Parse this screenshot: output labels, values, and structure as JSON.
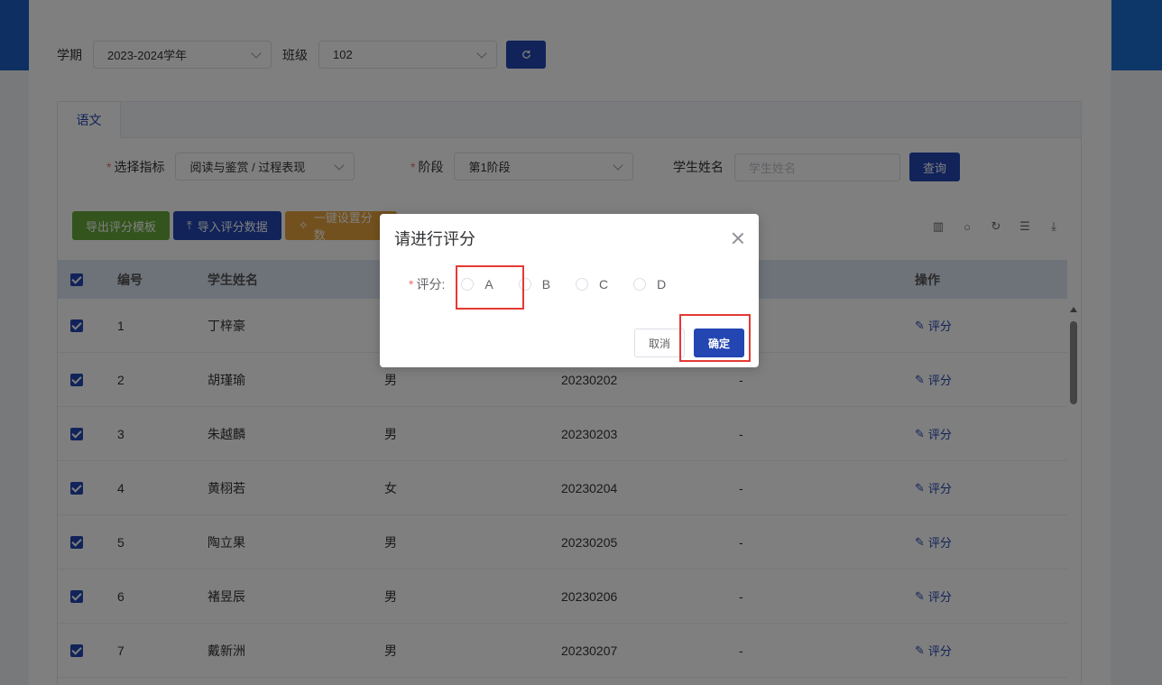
{
  "filters": {
    "term_label": "学期",
    "term_value": "2023-2024学年",
    "class_label": "班级",
    "class_value": "102",
    "refresh_icon": "refresh-icon"
  },
  "tabs": [
    {
      "label": "语文"
    }
  ],
  "form": {
    "indicator_label": "选择指标",
    "indicator_value": "阅读与鉴赏 / 过程表现",
    "stage_label": "阶段",
    "stage_value": "第1阶段",
    "student_label": "学生姓名",
    "student_placeholder": "学生姓名",
    "query_label": "查询"
  },
  "toolbar": {
    "export_label": "导出评分模板",
    "import_label": "导入评分数据",
    "batch_label": "一键设置分数",
    "export_color": "#67a93b",
    "import_color": "#2346b3",
    "batch_color": "#e6a23c"
  },
  "table": {
    "headers": [
      "编号",
      "学生姓名",
      "操作"
    ],
    "rows": [
      {
        "no": "1",
        "name": "丁梓豪",
        "gender": "",
        "id": "",
        "score": "",
        "op": "评分"
      },
      {
        "no": "2",
        "name": "胡瑾瑜",
        "gender": "男",
        "id": "20230202",
        "score": "-",
        "op": "评分"
      },
      {
        "no": "3",
        "name": "朱越麟",
        "gender": "男",
        "id": "20230203",
        "score": "-",
        "op": "评分"
      },
      {
        "no": "4",
        "name": "黄栩若",
        "gender": "女",
        "id": "20230204",
        "score": "-",
        "op": "评分"
      },
      {
        "no": "5",
        "name": "陶立果",
        "gender": "男",
        "id": "20230205",
        "score": "-",
        "op": "评分"
      },
      {
        "no": "6",
        "name": "褚昱辰",
        "gender": "男",
        "id": "20230206",
        "score": "-",
        "op": "评分"
      },
      {
        "no": "7",
        "name": "戴新洲",
        "gender": "男",
        "id": "20230207",
        "score": "-",
        "op": "评分"
      }
    ]
  },
  "dialog": {
    "title": "请进行评分",
    "rate_label": "评分:",
    "options": [
      "A",
      "B",
      "C",
      "D"
    ],
    "cancel_label": "取消",
    "ok_label": "确定"
  },
  "colors": {
    "primary": "#2346b3",
    "highlight": "#e53935"
  }
}
